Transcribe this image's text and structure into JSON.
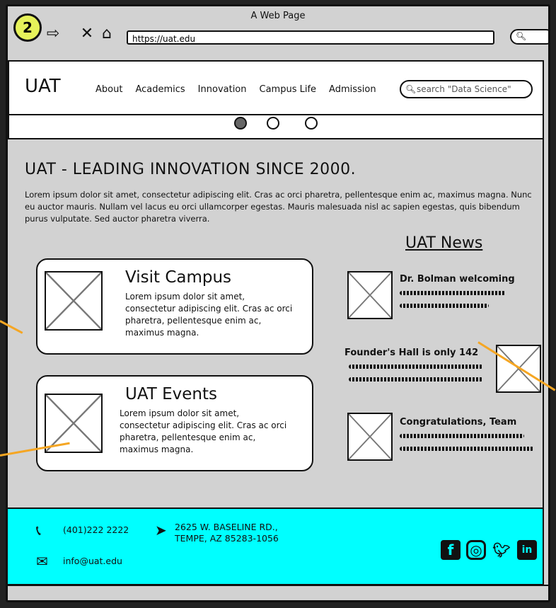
{
  "window": {
    "title": "A Web Page",
    "step_badge": "2",
    "url": "https://uat.edu"
  },
  "header": {
    "logo": "UAT",
    "nav": [
      "About",
      "Academics",
      "Innovation",
      "Campus Life",
      "Admission"
    ],
    "search_placeholder": "search \"Data Science\""
  },
  "carousel": {
    "active_index": 0,
    "count": 3
  },
  "main": {
    "title": "UAT - LEADING INNOVATION SINCE 2000.",
    "intro": "Lorem ipsum dolor sit amet, consectetur adipiscing elit. Cras ac orci pharetra, pellentesque enim ac, maximus magna. Nunc eu auctor mauris. Nullam vel lacus eu orci ullamcorper egestas. Mauris malesuada nisl ac sapien egestas, quis bibendum purus vulputate. Sed auctor pharetra viverra.",
    "cards": [
      {
        "title": "Visit Campus",
        "text": "Lorem ipsum dolor sit amet, consectetur adipiscing elit. Cras ac orci pharetra, pellentesque enim ac, maximus magna."
      },
      {
        "title": "UAT Events",
        "text": "Lorem ipsum dolor sit amet, consectetur adipiscing elit. Cras ac orci pharetra, pellentesque enim ac, maximus magna."
      }
    ]
  },
  "news": {
    "heading": "UAT News",
    "items": [
      {
        "title": "Dr. Bolman welcoming"
      },
      {
        "title": "Founder's Hall is only 142"
      },
      {
        "title": "Congratulations, Team"
      }
    ]
  },
  "footer": {
    "phone": "(401)222 2222",
    "address_line1": "2625 W. BASELINE RD.,",
    "address_line2": "TEMPE, AZ 85283-1056",
    "email": "info@uat.edu",
    "social": [
      "facebook-icon",
      "instagram-icon",
      "twitter-icon",
      "linkedin-icon"
    ]
  },
  "colors": {
    "footer_bg": "#00ffff",
    "annotation_arrow": "#f5a623",
    "badge_yellow": "#e6f25a"
  }
}
